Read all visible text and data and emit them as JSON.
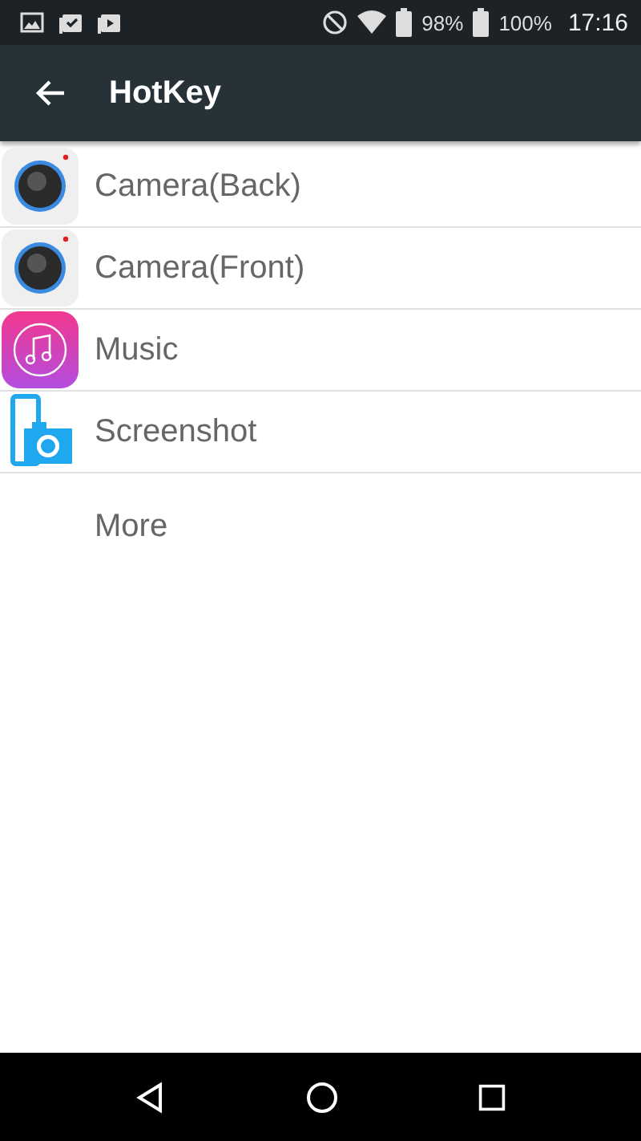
{
  "status_bar": {
    "battery_1": "98%",
    "battery_2": "100%",
    "time": "17:16"
  },
  "app_bar": {
    "title": "HotKey"
  },
  "items": [
    {
      "label": "Camera(Back)",
      "kind": "camera"
    },
    {
      "label": "Camera(Front)",
      "kind": "camera"
    },
    {
      "label": "Music",
      "kind": "music"
    },
    {
      "label": "Screenshot",
      "kind": "screenshot"
    },
    {
      "label": "More",
      "kind": "plain"
    }
  ]
}
